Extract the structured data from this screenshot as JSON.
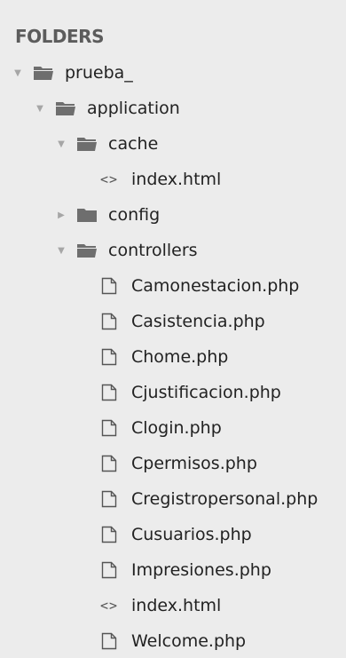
{
  "sidebar": {
    "title": "FOLDERS",
    "tree": [
      {
        "label": "prueba_",
        "type": "folder-open"
      },
      {
        "label": "application",
        "type": "folder-open"
      },
      {
        "label": "cache",
        "type": "folder-open"
      },
      {
        "label": "index.html",
        "type": "html-file"
      },
      {
        "label": "config",
        "type": "folder-closed"
      },
      {
        "label": "controllers",
        "type": "folder-open"
      },
      {
        "label": "Camonestacion.php",
        "type": "file"
      },
      {
        "label": "Casistencia.php",
        "type": "file"
      },
      {
        "label": "Chome.php",
        "type": "file"
      },
      {
        "label": "Cjustificacion.php",
        "type": "file"
      },
      {
        "label": "Clogin.php",
        "type": "file"
      },
      {
        "label": "Cpermisos.php",
        "type": "file"
      },
      {
        "label": "Cregistropersonal.php",
        "type": "file"
      },
      {
        "label": "Cusuarios.php",
        "type": "file"
      },
      {
        "label": "Impresiones.php",
        "type": "file"
      },
      {
        "label": "index.html",
        "type": "html-file"
      },
      {
        "label": "Welcome.php",
        "type": "file"
      }
    ],
    "icons": {
      "expanded": "chevron-down-icon",
      "collapsed": "chevron-right-icon",
      "html": "code-icon"
    }
  }
}
